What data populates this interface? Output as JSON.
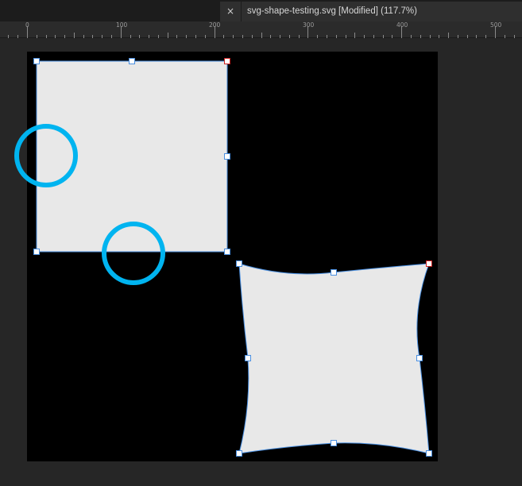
{
  "tab": {
    "close_glyph": "×",
    "title": "svg-shape-testing.svg [Modified] (117.7%)"
  },
  "ruler": {
    "labels": [
      "0",
      "100",
      "200",
      "300",
      "400",
      "500"
    ]
  },
  "colors": {
    "shape_fill": "#e8e8e8",
    "selection_stroke": "#4a8fe0",
    "handle_fill": "#ffffff",
    "corner_handle_stroke": "#cc2222",
    "annotation_circle": "#00b4f0",
    "artboard": "#000000"
  }
}
